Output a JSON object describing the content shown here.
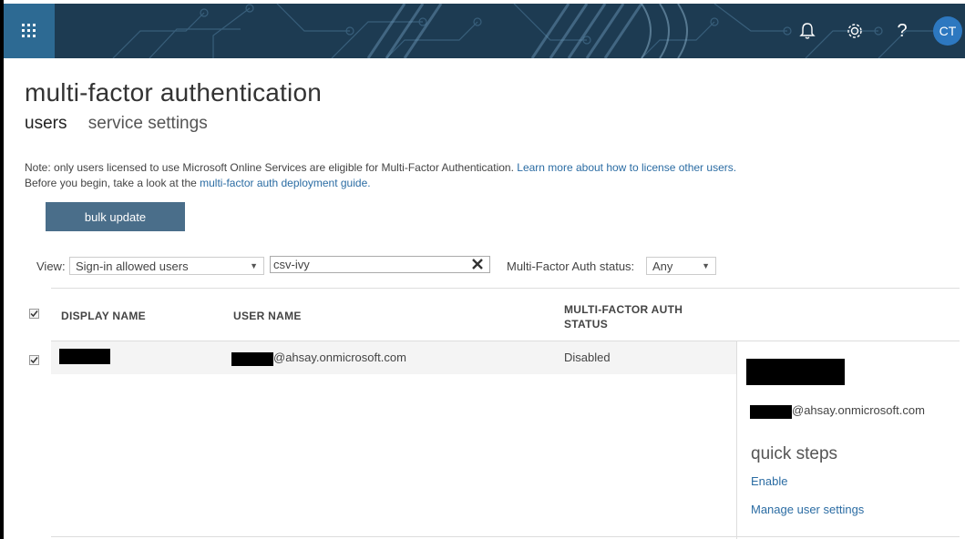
{
  "header": {
    "app_launcher_icon": "waffle-grid-icon",
    "notification_icon": "bell-icon",
    "settings_icon": "gear-icon",
    "help_icon": "question-icon",
    "avatar_initials": "CT",
    "background_color": "#1d3b52",
    "accent_color": "#2d6a93"
  },
  "page": {
    "title": "multi-factor authentication",
    "tabs": [
      {
        "label": "users",
        "active": true
      },
      {
        "label": "service settings",
        "active": false
      }
    ]
  },
  "note": {
    "line1_text": "Note: only users licensed to use Microsoft Online Services are eligible for Multi-Factor Authentication.",
    "line1_link": "Learn more about how to license other users.",
    "line2_text": "Before you begin, take a look at the",
    "line2_link": "multi-factor auth deployment guide."
  },
  "toolbar": {
    "bulk_update_label": "bulk update"
  },
  "filters": {
    "view_label": "View:",
    "view_selected": "Sign-in allowed users",
    "search_value": "csv-ivy",
    "mfa_status_label": "Multi-Factor Auth status:",
    "mfa_status_selected": "Any"
  },
  "table": {
    "headers": {
      "display_name": "DISPLAY NAME",
      "user_name": "USER NAME",
      "mfa_status_line1": "MULTI-FACTOR AUTH",
      "mfa_status_line2": "STATUS"
    },
    "rows": [
      {
        "checked": true,
        "display_name": "",
        "user_name_domain": "@ahsay.onmicrosoft.com",
        "mfa_status": "Disabled"
      }
    ]
  },
  "details_panel": {
    "user_domain": "@ahsay.onmicrosoft.com",
    "quick_steps_title": "quick steps",
    "enable_label": "Enable",
    "manage_label": "Manage user settings"
  },
  "colors": {
    "link": "#2b6ca3",
    "button": "#4a6e8a",
    "selected_row": "#f4f4f4"
  }
}
